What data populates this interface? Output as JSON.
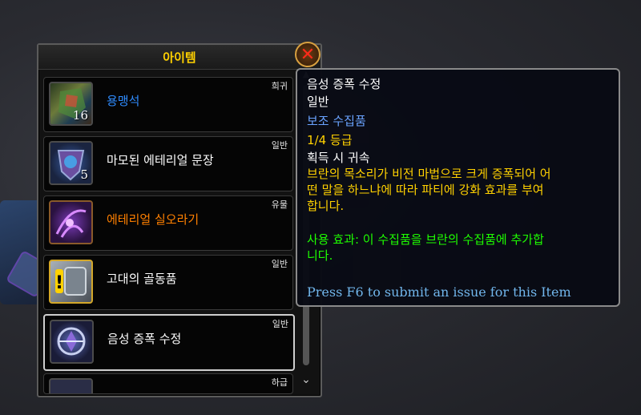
{
  "panel": {
    "title": "아이템",
    "close_glyph": "✕",
    "items": [
      {
        "name": "용맹석",
        "count": "16",
        "rarity": "희귀",
        "name_color": "#2f8cff",
        "icon": "valor-stone-icon"
      },
      {
        "name": "마모된 에테리얼 문장",
        "count": "5",
        "rarity": "일반",
        "name_color": "#ffffff",
        "icon": "worn-crest-icon"
      },
      {
        "name": "에테리얼 실오라기",
        "count": "",
        "rarity": "유물",
        "name_color": "#ff8000",
        "icon": "ethereal-strand-icon"
      },
      {
        "name": "고대의 골동품",
        "count": "",
        "rarity": "일반",
        "name_color": "#ffffff",
        "icon": "ancient-curio-icon"
      },
      {
        "name": "음성 증폭 수정",
        "count": "",
        "rarity": "일반",
        "name_color": "#ffffff",
        "icon": "voice-amplifier-crystal-icon"
      },
      {
        "name": "",
        "count": "",
        "rarity": "하급",
        "name_color": "#ffffff",
        "icon": "partial-item-icon"
      }
    ]
  },
  "tooltip": {
    "name": "음성 증폭 수정",
    "quality": "일반",
    "category": "보조 수집품",
    "rank": "1/4 등급",
    "binding": "획득 시 귀속",
    "description_line1": "브란의 목소리가 비전 마법으로 크게 증폭되어 어",
    "description_line2": "떤 말을 하느냐에 따라 파티에 강화 효과를 부여",
    "description_line3": "합니다.",
    "use_line1": "사용 효과: 이 수집품을 브란의 수집품에 추가합",
    "use_line2": "니다.",
    "footer": "Press F6 to submit an issue for this Item"
  },
  "colors": {
    "gold": "#ffd100",
    "rare_blue": "#2f8cff",
    "artifact_orange": "#ff8000",
    "use_green": "#1eff00"
  }
}
